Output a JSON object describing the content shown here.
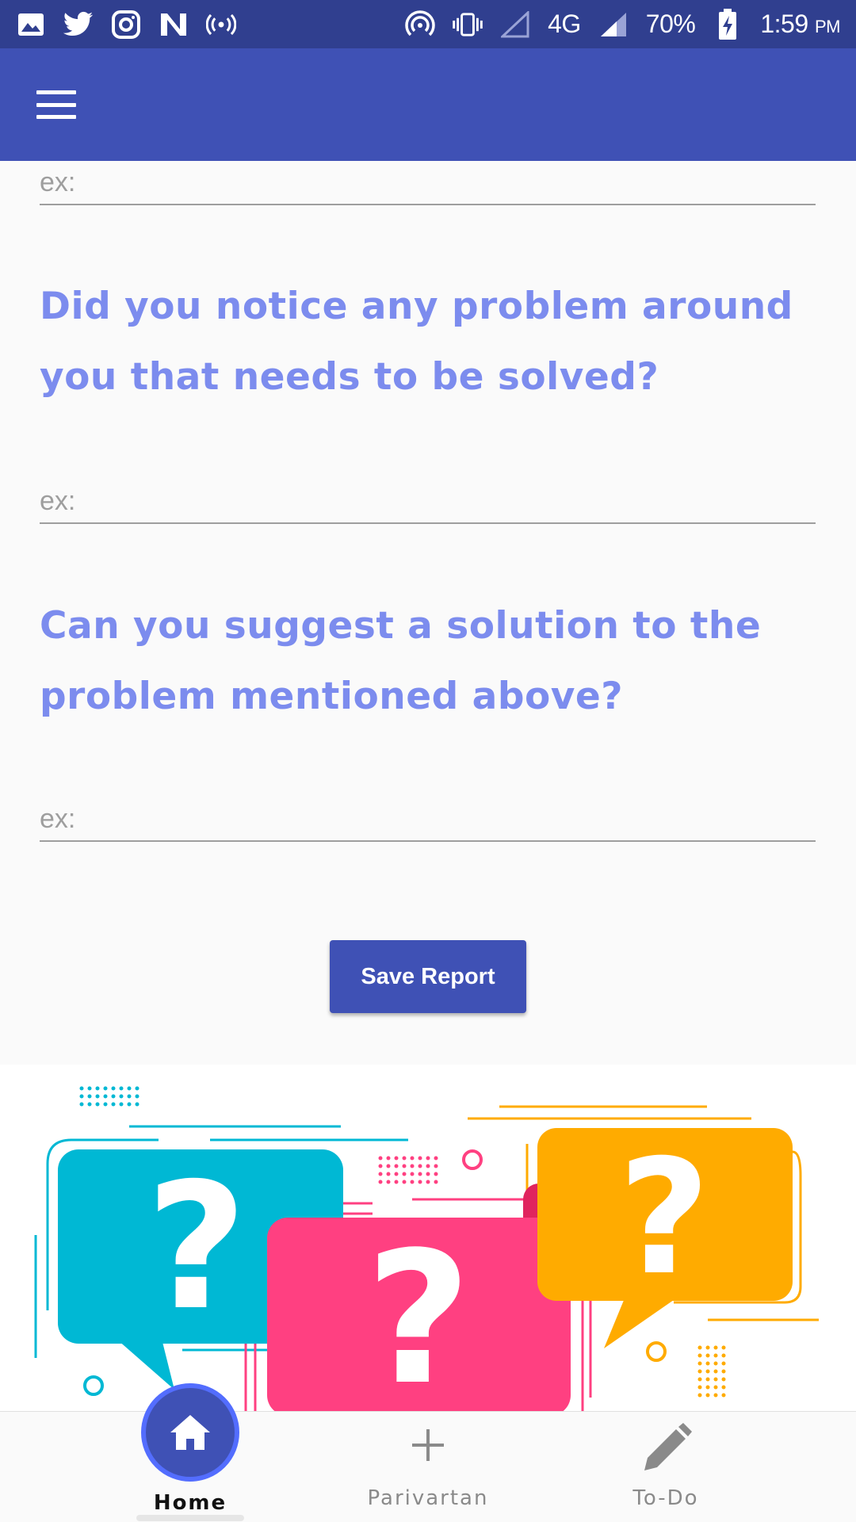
{
  "status_bar": {
    "battery": "70%",
    "network": "4G",
    "time": "1:59",
    "ampm": "PM",
    "left_icons": [
      "image-icon",
      "twitter-icon",
      "instagram-icon",
      "n-app-icon",
      "broadcast-icon"
    ],
    "right_icons": [
      "hotspot-icon",
      "vibrate-icon",
      "signal-empty-icon",
      "signal-icon",
      "battery-charging-icon"
    ]
  },
  "app_bar": {
    "menu_icon": "hamburger-menu-icon"
  },
  "form": {
    "field_1": {
      "placeholder": "ex:"
    },
    "question_2": "Did you notice any problem around you that needs to be solved?",
    "field_2": {
      "placeholder": "ex:"
    },
    "question_3": "Can you suggest a solution to the problem mentioned above?",
    "field_3": {
      "placeholder": "ex:"
    },
    "save_label": "Save Report"
  },
  "illustration": {
    "glyph": "?",
    "colors": {
      "teal": "#00b8d4",
      "pink": "#ff4081",
      "orange": "#ffab00"
    }
  },
  "bottom_nav": {
    "items": [
      {
        "label": "Home",
        "icon": "home-icon",
        "active": true
      },
      {
        "label": "Parivartan",
        "icon": "plus-icon",
        "active": false
      },
      {
        "label": "To-Do",
        "icon": "pencil-icon",
        "active": false
      }
    ]
  },
  "colors": {
    "primary": "#3f51b5",
    "primary_dark": "#303f8f",
    "question_text": "#7c8cee",
    "active_ring": "#536dfe"
  }
}
